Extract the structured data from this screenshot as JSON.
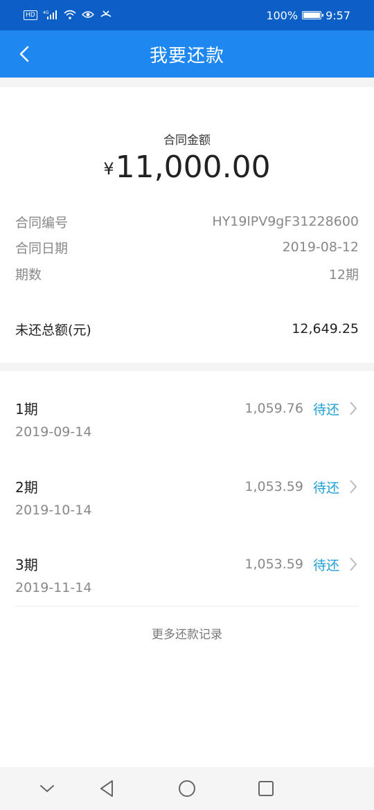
{
  "status_bar": {
    "left_badge": "HD",
    "battery_text": "100%",
    "time": "9:57"
  },
  "nav": {
    "title": "我要还款",
    "back_icon": "chevron-left-icon"
  },
  "contract": {
    "amount_label": "合同金额",
    "currency_symbol": "¥",
    "amount": "11,000.00",
    "fields": [
      {
        "label": "合同编号",
        "value": "HY19lPV9gF31228600"
      },
      {
        "label": "合同日期",
        "value": "2019-08-12"
      },
      {
        "label": "期数",
        "value": "12期"
      }
    ],
    "outstanding_label": "未还总额(元)",
    "outstanding_value": "12,649.25"
  },
  "periods": [
    {
      "name": "1期",
      "date": "2019-09-14",
      "amount": "1,059.76",
      "status": "待还"
    },
    {
      "name": "2期",
      "date": "2019-10-14",
      "amount": "1,053.59",
      "status": "待还"
    },
    {
      "name": "3期",
      "date": "2019-11-14",
      "amount": "1,053.59",
      "status": "待还"
    }
  ],
  "more_records": "更多还款记录",
  "colors": {
    "status_bar": "#0b5fc7",
    "nav_bar": "#1e88f0",
    "status_link": "#1e9fd8"
  }
}
